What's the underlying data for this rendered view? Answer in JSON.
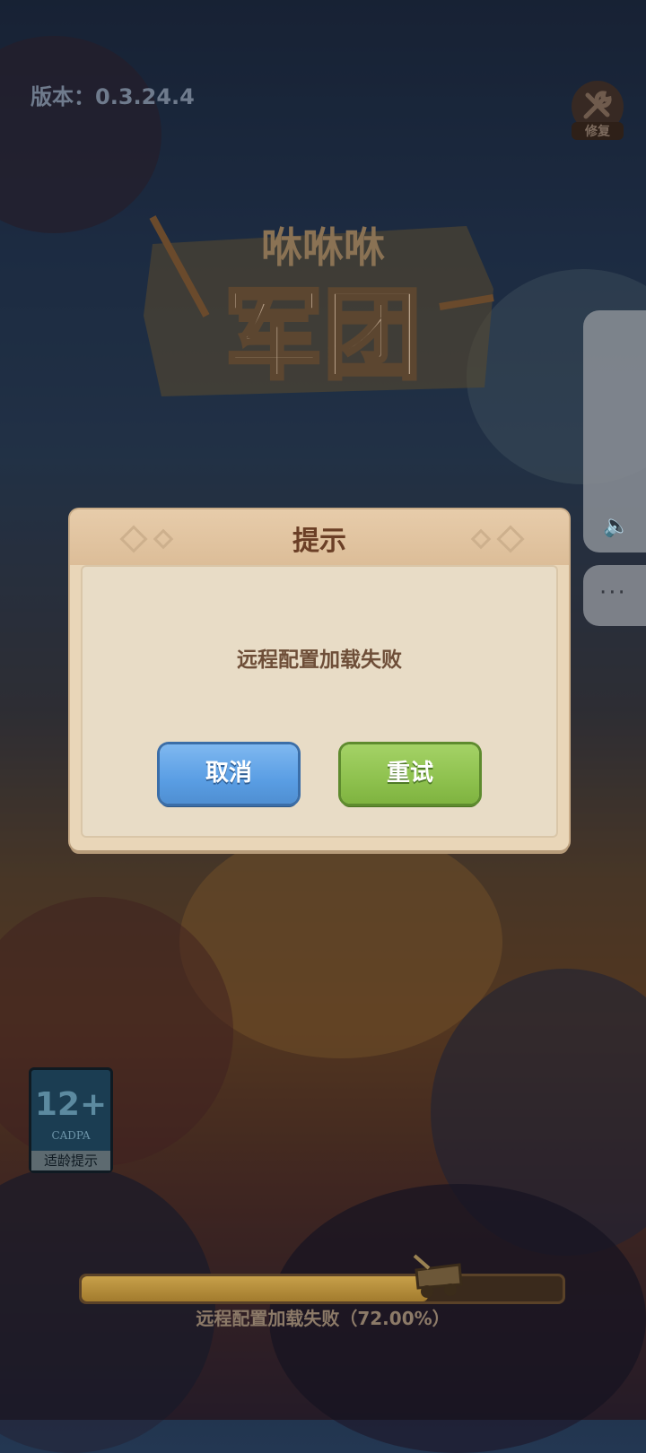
{
  "version_text": "版本：0.3.24.4",
  "repair": {
    "label": "修复",
    "icon": "wrench-icon"
  },
  "logo": {
    "top_text": "咻咻咻",
    "main_text": "军团"
  },
  "side_panel": {
    "sound_icon": "speaker-icon",
    "more_label": "···"
  },
  "dialog": {
    "title": "提示",
    "message": "远程配置加载失败",
    "cancel_label": "取消",
    "retry_label": "重试"
  },
  "age_rating": {
    "age": "12+",
    "org": "CADPA",
    "label": "适龄提示"
  },
  "loading": {
    "progress": 0.72,
    "status_text": "远程配置加载失败（72.00%）"
  },
  "colors": {
    "cancel": "#5a9ee4",
    "retry": "#8ec14e",
    "dialog_bg": "#e9d6b8",
    "title": "#6b3f26"
  }
}
